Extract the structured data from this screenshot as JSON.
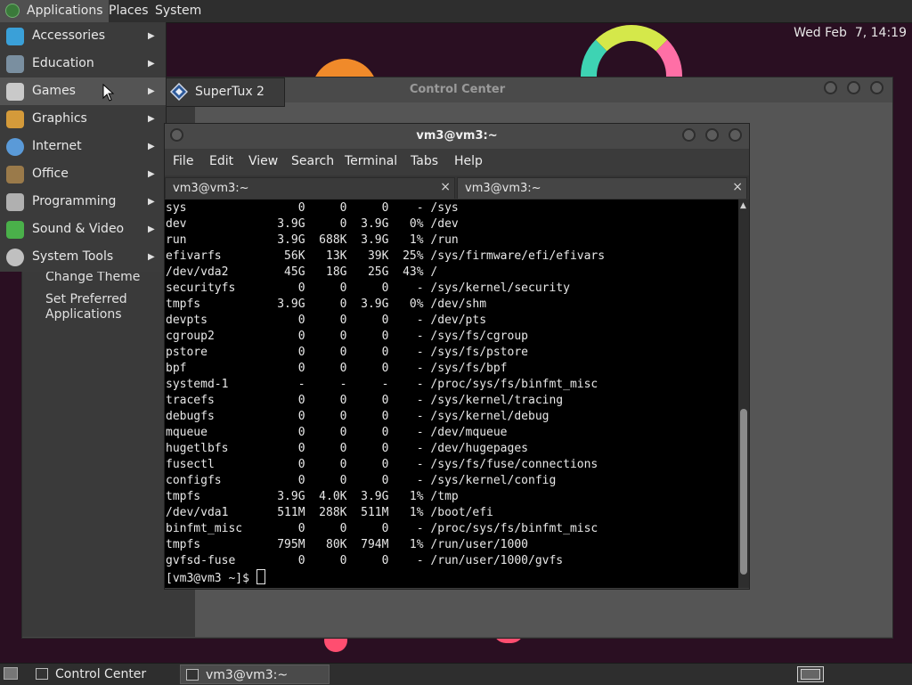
{
  "top_panel": {
    "applications": "Applications",
    "places": "Places",
    "system": "System",
    "clock": "Wed Feb  7, 14:19"
  },
  "apps_menu": {
    "items": [
      {
        "label": "Accessories",
        "icon": "accessories-icon",
        "color": "#3aa0d8"
      },
      {
        "label": "Education",
        "icon": "education-icon",
        "color": "#7a8fa0"
      },
      {
        "label": "Games",
        "icon": "games-icon",
        "color": "#c9c9c9"
      },
      {
        "label": "Graphics",
        "icon": "graphics-icon",
        "color": "#d49a3a"
      },
      {
        "label": "Internet",
        "icon": "internet-icon",
        "color": "#5a9ad8"
      },
      {
        "label": "Office",
        "icon": "office-icon",
        "color": "#9a7a4a"
      },
      {
        "label": "Programming",
        "icon": "programming-icon",
        "color": "#b0b0b0"
      },
      {
        "label": "Sound & Video",
        "icon": "sound-video-icon",
        "color": "#4ab04a"
      },
      {
        "label": "System Tools",
        "icon": "system-tools-icon",
        "color": "#c0c0c0"
      }
    ],
    "arrow": "▶"
  },
  "games_submenu": {
    "label": "SuperTux 2"
  },
  "control_center": {
    "title": "Control Center",
    "side_items": [
      "Change Theme",
      "Set Preferred\nApplications"
    ]
  },
  "terminal": {
    "title": "vm3@vm3:~",
    "menu": [
      "File",
      "Edit",
      "View",
      "Search",
      "Terminal",
      "Tabs",
      "Help"
    ],
    "tabs": [
      {
        "label": "vm3@vm3:~",
        "close": "×"
      },
      {
        "label": "vm3@vm3:~",
        "close": "×"
      }
    ],
    "lines": [
      "sys                0     0     0    - /sys",
      "dev             3.9G     0  3.9G   0% /dev",
      "run             3.9G  688K  3.9G   1% /run",
      "efivarfs         56K   13K   39K  25% /sys/firmware/efi/efivars",
      "/dev/vda2        45G   18G   25G  43% /",
      "securityfs         0     0     0    - /sys/kernel/security",
      "tmpfs           3.9G     0  3.9G   0% /dev/shm",
      "devpts             0     0     0    - /dev/pts",
      "cgroup2            0     0     0    - /sys/fs/cgroup",
      "pstore             0     0     0    - /sys/fs/pstore",
      "bpf                0     0     0    - /sys/fs/bpf",
      "systemd-1          -     -     -    - /proc/sys/fs/binfmt_misc",
      "tracefs            0     0     0    - /sys/kernel/tracing",
      "debugfs            0     0     0    - /sys/kernel/debug",
      "mqueue             0     0     0    - /dev/mqueue",
      "hugetlbfs          0     0     0    - /dev/hugepages",
      "fusectl            0     0     0    - /sys/fs/fuse/connections",
      "configfs           0     0     0    - /sys/kernel/config",
      "tmpfs           3.9G  4.0K  3.9G   1% /tmp",
      "/dev/vda1       511M  288K  511M   1% /boot/efi",
      "binfmt_misc        0     0     0    - /proc/sys/fs/binfmt_misc",
      "tmpfs           795M   80K  794M   1% /run/user/1000",
      "gvfsd-fuse         0     0     0    - /run/user/1000/gvfs"
    ],
    "prompt": "[vm3@vm3 ~]$ "
  },
  "bottom_panel": {
    "tasks": [
      {
        "label": "Control Center"
      },
      {
        "label": "vm3@vm3:~"
      }
    ]
  }
}
